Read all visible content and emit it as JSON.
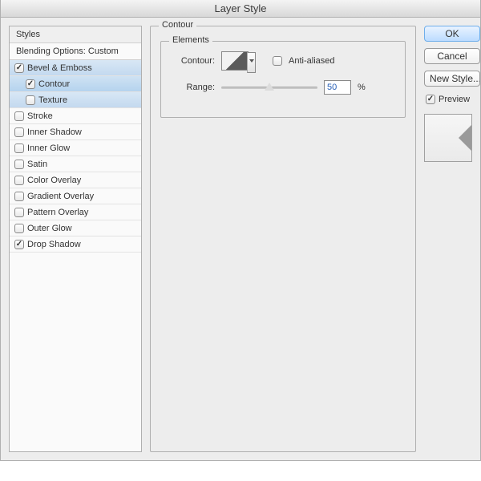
{
  "window": {
    "title": "Layer Style"
  },
  "styles": {
    "header": "Styles",
    "blending": "Blending Options: Custom",
    "items": [
      {
        "label": "Bevel & Emboss",
        "checked": true,
        "selected": false,
        "sub": false,
        "highlighted": true
      },
      {
        "label": "Contour",
        "checked": true,
        "selected": true,
        "sub": true,
        "highlighted": true
      },
      {
        "label": "Texture",
        "checked": false,
        "selected": false,
        "sub": true,
        "highlighted": true
      },
      {
        "label": "Stroke",
        "checked": false,
        "selected": false,
        "sub": false,
        "highlighted": false
      },
      {
        "label": "Inner Shadow",
        "checked": false,
        "selected": false,
        "sub": false,
        "highlighted": false
      },
      {
        "label": "Inner Glow",
        "checked": false,
        "selected": false,
        "sub": false,
        "highlighted": false
      },
      {
        "label": "Satin",
        "checked": false,
        "selected": false,
        "sub": false,
        "highlighted": false
      },
      {
        "label": "Color Overlay",
        "checked": false,
        "selected": false,
        "sub": false,
        "highlighted": false
      },
      {
        "label": "Gradient Overlay",
        "checked": false,
        "selected": false,
        "sub": false,
        "highlighted": false
      },
      {
        "label": "Pattern Overlay",
        "checked": false,
        "selected": false,
        "sub": false,
        "highlighted": false
      },
      {
        "label": "Outer Glow",
        "checked": false,
        "selected": false,
        "sub": false,
        "highlighted": false
      },
      {
        "label": "Drop Shadow",
        "checked": true,
        "selected": false,
        "sub": false,
        "highlighted": false
      }
    ]
  },
  "main": {
    "section_title": "Contour",
    "elements_title": "Elements",
    "contour_label": "Contour:",
    "antialiased_label": "Anti-aliased",
    "antialiased_checked": false,
    "range_label": "Range:",
    "range_value": "50",
    "range_unit": "%"
  },
  "right": {
    "ok": "OK",
    "cancel": "Cancel",
    "new_style": "New Style...",
    "preview_label": "Preview",
    "preview_checked": true
  }
}
